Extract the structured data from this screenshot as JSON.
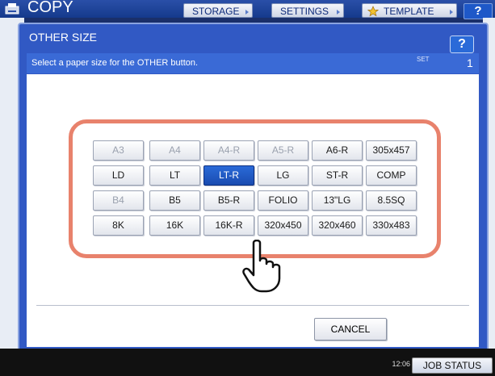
{
  "app": {
    "title": "COPY"
  },
  "topbar": {
    "buttons": [
      "STORAGE",
      "SETTINGS",
      "TEMPLATE"
    ],
    "help": "?"
  },
  "dialog": {
    "title": "OTHER SIZE",
    "help": "?",
    "message": "Select a paper size for the OTHER button.",
    "set_label": "SET",
    "set_value": "1",
    "cancel": "CANCEL"
  },
  "sizes": [
    [
      {
        "label": "A3",
        "state": "disabled"
      },
      {
        "label": "A4",
        "state": "disabled"
      },
      {
        "label": "A4-R",
        "state": "disabled"
      },
      {
        "label": "A5-R",
        "state": "disabled"
      },
      {
        "label": "A6-R",
        "state": "normal"
      },
      {
        "label": "305x457",
        "state": "normal"
      }
    ],
    [
      {
        "label": "LD",
        "state": "normal"
      },
      {
        "label": "LT",
        "state": "normal"
      },
      {
        "label": "LT-R",
        "state": "selected"
      },
      {
        "label": "LG",
        "state": "normal"
      },
      {
        "label": "ST-R",
        "state": "normal"
      },
      {
        "label": "COMP",
        "state": "normal"
      }
    ],
    [
      {
        "label": "B4",
        "state": "disabled"
      },
      {
        "label": "B5",
        "state": "normal"
      },
      {
        "label": "B5-R",
        "state": "normal"
      },
      {
        "label": "FOLIO",
        "state": "normal"
      },
      {
        "label": "13\"LG",
        "state": "normal"
      },
      {
        "label": "8.5SQ",
        "state": "normal"
      }
    ],
    [
      {
        "label": "8K",
        "state": "normal"
      },
      {
        "label": "16K",
        "state": "normal"
      },
      {
        "label": "16K-R",
        "state": "normal"
      },
      {
        "label": "320x450",
        "state": "normal"
      },
      {
        "label": "320x460",
        "state": "normal"
      },
      {
        "label": "330x483",
        "state": "normal"
      }
    ]
  ],
  "status": {
    "time": "12:06",
    "job_status": "JOB STATUS"
  },
  "colors": {
    "accent": "#3159c4",
    "highlight": "#e8826c",
    "selected": "#1a4cb0"
  },
  "icons": [
    "copy-app-icon",
    "star-icon",
    "pointing-hand-icon",
    "chevron-right-icon"
  ]
}
